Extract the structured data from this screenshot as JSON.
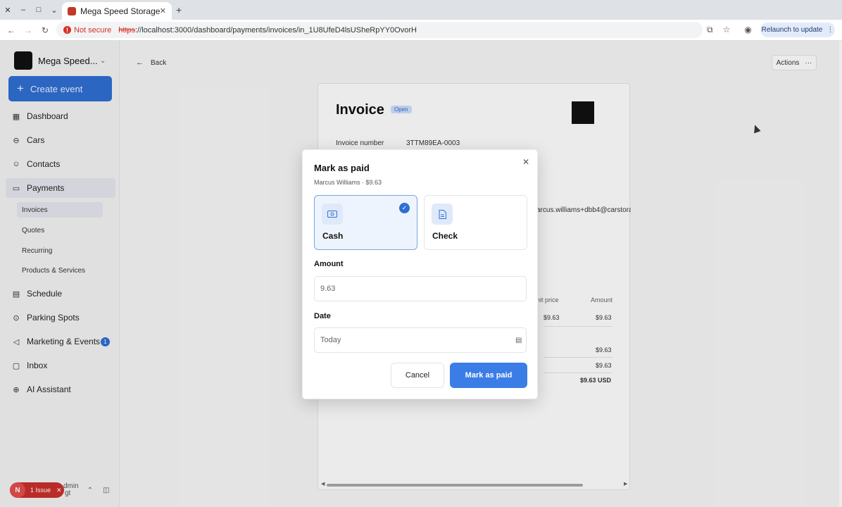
{
  "browser": {
    "tab_title": "Mega Speed Storage",
    "not_secure": "Not secure",
    "url_scheme": "https",
    "url_rest": "://localhost:3000/dashboard/payments/invoices/in_1U8UfeD4lsUSheRpYY0OvorH",
    "relaunch": "Relaunch to update"
  },
  "sidebar": {
    "brand_name": "Mega Speed...",
    "create_label": "Create event",
    "items": [
      {
        "label": "Dashboard",
        "icon": "grid-icon"
      },
      {
        "label": "Cars",
        "icon": "car-icon"
      },
      {
        "label": "Contacts",
        "icon": "users-icon"
      },
      {
        "label": "Payments",
        "icon": "card-icon"
      },
      {
        "label": "Schedule",
        "icon": "calendar-icon"
      },
      {
        "label": "Parking Spots",
        "icon": "pin-icon"
      },
      {
        "label": "Marketing & Events",
        "icon": "megaphone-icon"
      },
      {
        "label": "Inbox",
        "icon": "inbox-icon"
      },
      {
        "label": "AI Assistant",
        "icon": "ai-icon"
      }
    ],
    "sub_items": [
      "Invoices",
      "Quotes",
      "Recurring",
      "Products & Services"
    ],
    "marketing_badge": "1",
    "user_name": "dmin",
    "user_sub": "gt"
  },
  "issue": {
    "letter": "N",
    "label": "1 Issue"
  },
  "main": {
    "back_label": "Back",
    "actions_label": "Actions",
    "invoice": {
      "title": "Invoice",
      "status": "Open",
      "number_label": "Invoice number",
      "number_value": "3TTM89EA-0003",
      "email": "arcus.williams+dbb4@carstora",
      "unit_price_header": "nit price",
      "amount_header": "Amount",
      "line_unit_price": "$9.63",
      "line_amount": "$9.63",
      "subtotal": "$9.63",
      "total_line": "$9.63",
      "amount_due": "$9.63 USD"
    }
  },
  "modal": {
    "title": "Mark as paid",
    "subtitle": "Marcus Williams · $9.63",
    "methods": [
      {
        "label": "Cash",
        "selected": true,
        "icon": "cash-icon"
      },
      {
        "label": "Check",
        "selected": false,
        "icon": "document-icon"
      }
    ],
    "amount_label": "Amount",
    "amount_value": "9.63",
    "date_label": "Date",
    "date_value": "Today",
    "cancel_label": "Cancel",
    "confirm_label": "Mark as paid"
  },
  "colors": {
    "primary": "#3b7de6",
    "danger": "#c9302c"
  }
}
